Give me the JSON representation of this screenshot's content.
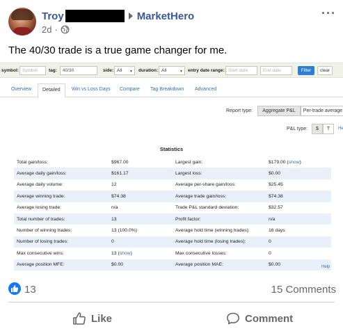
{
  "post": {
    "author": "Troy",
    "group": "MarketHero",
    "time": "2d",
    "separator": "·",
    "text": "The 40/30 trade is a true game changer for me."
  },
  "icons": {
    "privacy": "globe-icon",
    "group_arrow": "triangle-right-icon",
    "more": "ellipsis-icon",
    "like_badge": "thumbs-up-icon",
    "like_action": "thumbs-up-outline-icon",
    "comment_action": "speech-bubble-icon",
    "select_caret": "chevron-down-icon"
  },
  "colors": {
    "link": "#385898",
    "facebook_blue": "#1877f2",
    "muted": "#65676b",
    "filter_button": "#2f7fd1",
    "row_stripe": "#eaf0fa",
    "filter_bar": "#f0f2e8"
  },
  "filters": {
    "symbol_label": "symbol:",
    "symbol_placeholder": "Symbol",
    "tag_label": "tag:",
    "tag_value": "40/30",
    "side_label": "side:",
    "side_value": "All",
    "duration_label": "duration:",
    "duration_value": "All",
    "date_range_label": "entry date range:",
    "start_placeholder": "Start date",
    "end_placeholder": "End date",
    "filter_button": "Filter",
    "clear_button": "clear"
  },
  "tabs": [
    {
      "label": "Overview"
    },
    {
      "label": "Detailed"
    },
    {
      "label": "Win vs Loss Days"
    },
    {
      "label": "Compare"
    },
    {
      "label": "Tag Breakdown"
    },
    {
      "label": "Advanced"
    }
  ],
  "active_tab": "Detailed",
  "report": {
    "type_label": "Report type:",
    "type_options": [
      "Aggregate P&L",
      "Per-trade average"
    ],
    "type_selected": "Aggregate P&L",
    "pl_label": "P&L type:",
    "pl_options": [
      "$",
      "T"
    ],
    "pl_selected": "$",
    "help_partial": "He"
  },
  "stats": {
    "title": "Statistics",
    "show_text": "show",
    "help": "Help",
    "rows": [
      {
        "l1": "Total gain/loss:",
        "v1": "$967.00",
        "l2": "Largest gain:",
        "v2": "$179.00 (",
        "v2_link": "show",
        "v2_end": ")"
      },
      {
        "l1": "Average daily gain/loss:",
        "v1": "$161.17",
        "l2": "Largest loss:",
        "v2": "$0.00"
      },
      {
        "l1": "Average daily volume:",
        "v1": "12",
        "l2": "Average per-share gain/loss:",
        "v2": "$25.45"
      },
      {
        "l1": "Average winning trade:",
        "v1": "$74.38",
        "l2": "Average trade gain/loss:",
        "v2": "$74.38"
      },
      {
        "l1": "Average losing trade:",
        "v1": "n/a",
        "l2": "Trade P&L standard deviation:",
        "v2": "$32.57"
      },
      {
        "l1": "Total number of trades:",
        "v1": "13",
        "l2": "Profit factor:",
        "v2": "n/a"
      },
      {
        "l1": "Number of winning trades:",
        "v1": "13 (100.0%)",
        "l2": "Average hold time (winning trades):",
        "v2": "16 days"
      },
      {
        "l1": "Number of losing trades:",
        "v1": "0",
        "l2": "Average hold time (losing trades):",
        "v2": "0"
      },
      {
        "l1": "Max consecutive wins:",
        "v1": "13 (",
        "v1_link": "show",
        "v1_end": ")",
        "l2": "Max consecutive losses:",
        "v2": "0"
      },
      {
        "l1": "Average position MFE:",
        "v1": "$0.00",
        "l2": "Average position MAE:",
        "v2": "$0.00"
      }
    ]
  },
  "engagement": {
    "likes": "13",
    "comments": "15 Comments",
    "like_label": "Like",
    "comment_label": "Comment"
  }
}
